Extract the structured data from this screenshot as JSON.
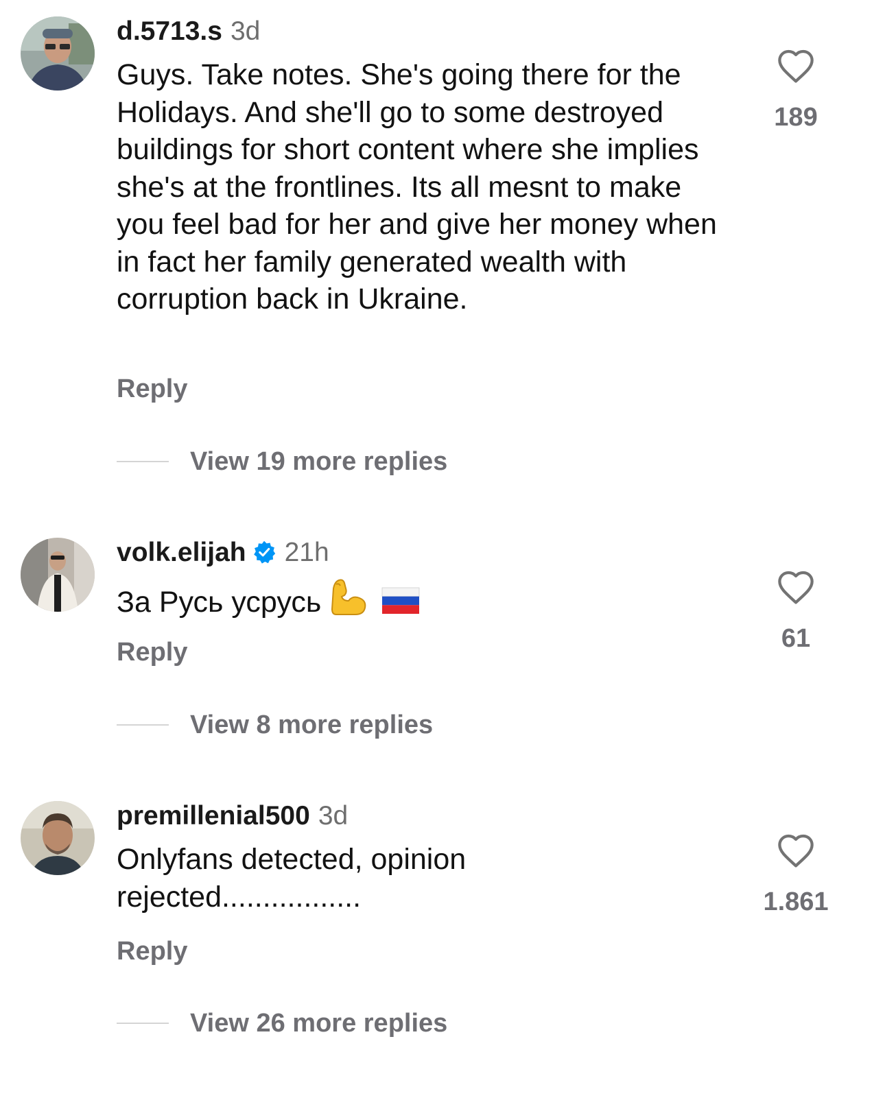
{
  "comments": [
    {
      "username": "d.5713.s",
      "time": "3d",
      "body": "Guys. Take notes. She's going there for the Holidays. And she'll go to some destroyed buildings for short content where she implies she's at the frontlines. Its all mesnt to make you feel bad for her and give her money when in fact her family generated wealth with corruption back in Ukraine.",
      "reply_label": "Reply",
      "view_replies": "View 19 more replies",
      "likes": "189"
    },
    {
      "username": "volk.elijah",
      "time": "21h",
      "body": "За Русь усрусь",
      "reply_label": "Reply",
      "view_replies": "View 8 more replies",
      "likes": "61",
      "verified": true,
      "emojis": [
        "flexed-biceps",
        "flag-russia"
      ]
    },
    {
      "username": "premillenial500",
      "time": "3d",
      "body": "Onlyfans detected, opinion rejected.................",
      "reply_label": "Reply",
      "view_replies": "View 26 more replies",
      "likes": "1.861"
    }
  ],
  "icons": {
    "like": "heart-outline-icon",
    "verified": "verified-badge-icon"
  },
  "colors": {
    "text": "#121212",
    "secondary": "#6e6e73",
    "verified": "#0095f6",
    "divider": "#d4d4d4"
  }
}
